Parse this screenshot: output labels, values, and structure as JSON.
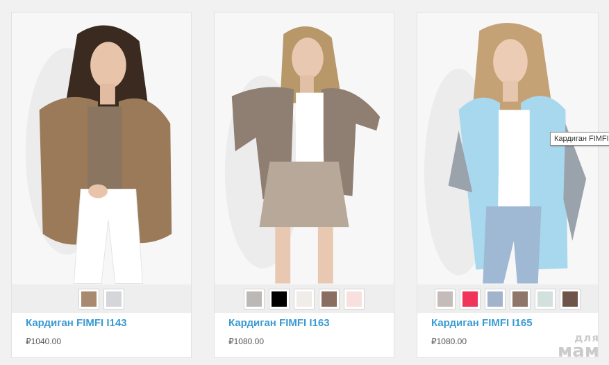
{
  "products": [
    {
      "name": "Кардиган FIMFI I143",
      "price": "₽1040.00",
      "swatches": [
        "#a88a70",
        "#d4d6da"
      ]
    },
    {
      "name": "Кардиган FIMFI I163",
      "price": "₽1080.00",
      "swatches": [
        "#bcb8b6",
        "#000000",
        "#f0ece8",
        "#8a6e60",
        "#f8e0de"
      ]
    },
    {
      "name": "Кардиган FIMFI I165",
      "price": "₽1080.00",
      "swatches": [
        "#c4bcb8",
        "#f0345a",
        "#a2b4cc",
        "#8e7668",
        "#d2e0de",
        "#6e554a"
      ]
    }
  ],
  "tooltip": "Кардиган FIMFI",
  "watermark": {
    "line1": "для",
    "line2": "мам"
  }
}
